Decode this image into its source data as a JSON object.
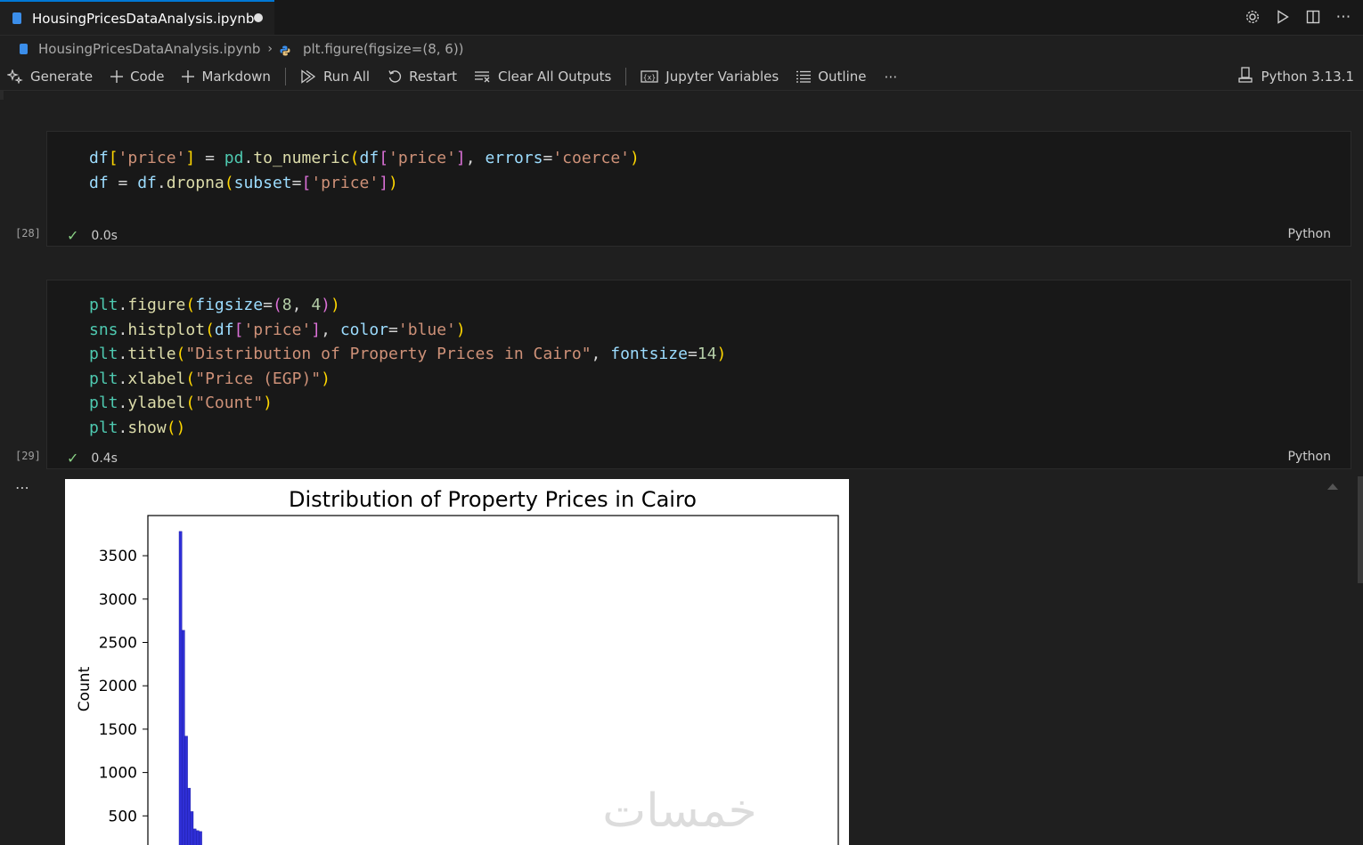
{
  "tab": {
    "title": "HousingPricesDataAnalysis.ipynb"
  },
  "tab_actions": [
    "gear-icon",
    "run-icon",
    "split-editor-icon",
    "more-icon"
  ],
  "breadcrumb": {
    "file": "HousingPricesDataAnalysis.ipynb",
    "symbol": "plt.figure(figsize=(8, 6))"
  },
  "toolbar": {
    "generate": "Generate",
    "code": "Code",
    "markdown": "Markdown",
    "run_all": "Run All",
    "restart": "Restart",
    "clear_outputs": "Clear All Outputs",
    "variables": "Jupyter Variables",
    "outline": "Outline",
    "more": "⋯",
    "kernel": "Python 3.13.1"
  },
  "cells": [
    {
      "exec_count": "[28]",
      "duration": "0.0s",
      "language": "Python",
      "lines": [
        "df['price'] = pd.to_numeric(df['price'], errors='coerce')",
        "df = df.dropna(subset=['price'])"
      ]
    },
    {
      "exec_count": "[29]",
      "duration": "0.4s",
      "language": "Python",
      "lines": [
        "plt.figure(figsize=(8, 4))",
        "sns.histplot(df['price'], color='blue')",
        "plt.title(\"Distribution of Property Prices in Cairo\", fontsize=14)",
        "plt.xlabel(\"Price (EGP)\")",
        "plt.ylabel(\"Count\")",
        "plt.show()"
      ]
    }
  ],
  "output_more": "⋯",
  "watermark": "خمسات",
  "chart_data": {
    "type": "bar",
    "title": "Distribution of Property Prices in Cairo",
    "xlabel": "",
    "ylabel": "Count",
    "yticks": [
      500,
      1000,
      1500,
      2000,
      2500,
      3000,
      3500
    ],
    "ylim": [
      0,
      3900
    ],
    "bar_color": "#2f2fd6",
    "values": [
      3780,
      2640,
      1420,
      820,
      550,
      350,
      330,
      320
    ],
    "grid": false
  }
}
